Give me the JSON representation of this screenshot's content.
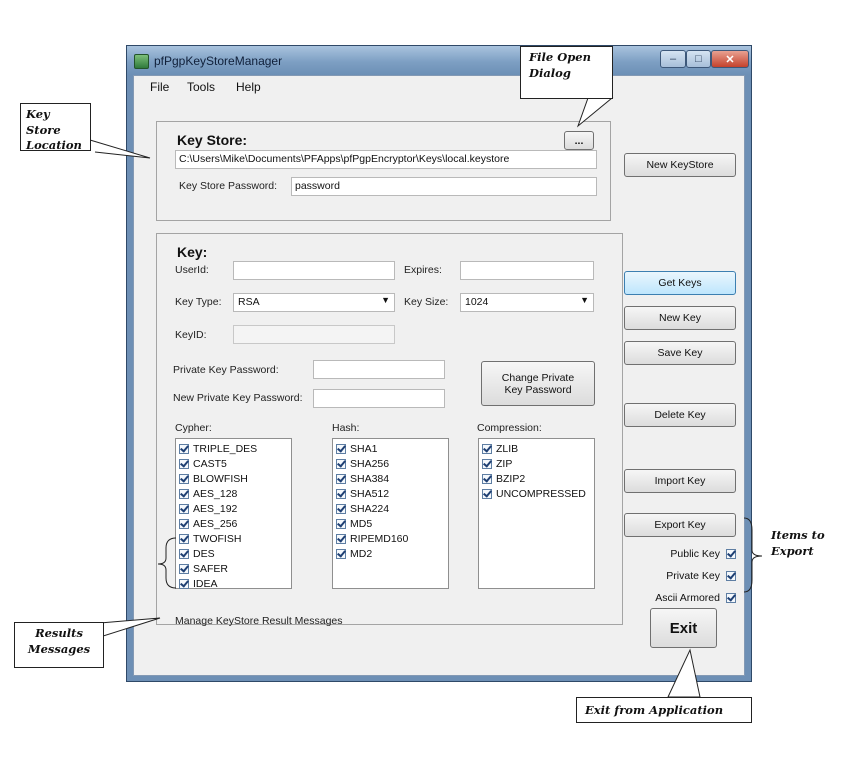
{
  "window": {
    "title": "pfPgpKeyStoreManager"
  },
  "menu": [
    "File",
    "Tools",
    "Help"
  ],
  "keystore": {
    "title": "Key Store:",
    "browse_label": "...",
    "path": "C:\\Users\\Mike\\Documents\\PFApps\\pfPgpEncryptor\\Keys\\local.keystore",
    "password_label": "Key Store Password:",
    "password_value": "password"
  },
  "key": {
    "title": "Key:",
    "userid_label": "UserId:",
    "userid_value": "",
    "expires_label": "Expires:",
    "expires_value": "",
    "keytype_label": "Key Type:",
    "keytype_value": "RSA",
    "keysize_label": "Key Size:",
    "keysize_value": "1024",
    "keyid_label": "KeyID:",
    "keyid_value": "",
    "private_pw_label": "Private Key Password:",
    "new_private_pw_label": "New Private Key Password:",
    "change_pw_button_line1": "Change Private",
    "change_pw_button_line2": "Key Password",
    "cypher_label": "Cypher:",
    "hash_label": "Hash:",
    "compression_label": "Compression:",
    "cyphers": [
      "TRIPLE_DES",
      "CAST5",
      "BLOWFISH",
      "AES_128",
      "AES_192",
      "AES_256",
      "TWOFISH",
      "DES",
      "SAFER",
      "IDEA"
    ],
    "hashes": [
      "SHA1",
      "SHA256",
      "SHA384",
      "SHA512",
      "SHA224",
      "MD5",
      "RIPEMD160",
      "MD2"
    ],
    "compressions": [
      "ZLIB",
      "ZIP",
      "BZIP2",
      "UNCOMPRESSED"
    ]
  },
  "buttons": {
    "new_keystore": "New KeyStore",
    "get_keys": "Get Keys",
    "new_key": "New Key",
    "save_key": "Save Key",
    "delete_key": "Delete Key",
    "import_key": "Import Key",
    "export_key": "Export Key",
    "exit": "Exit"
  },
  "export_options": [
    {
      "label": "Public Key",
      "checked": true
    },
    {
      "label": "Private Key",
      "checked": true
    },
    {
      "label": "Ascii Armored",
      "checked": true
    }
  ],
  "status": "Manage KeyStore Result Messages",
  "callouts": {
    "keystore_location_1": "Key Store",
    "keystore_location_2": "Location",
    "file_open_1": "File Open",
    "file_open_2": "Dialog",
    "results_1": "Results",
    "results_2": "Messages",
    "items_export_1": "Items to",
    "items_export_2": "Export",
    "exit_app": "Exit from Application"
  }
}
